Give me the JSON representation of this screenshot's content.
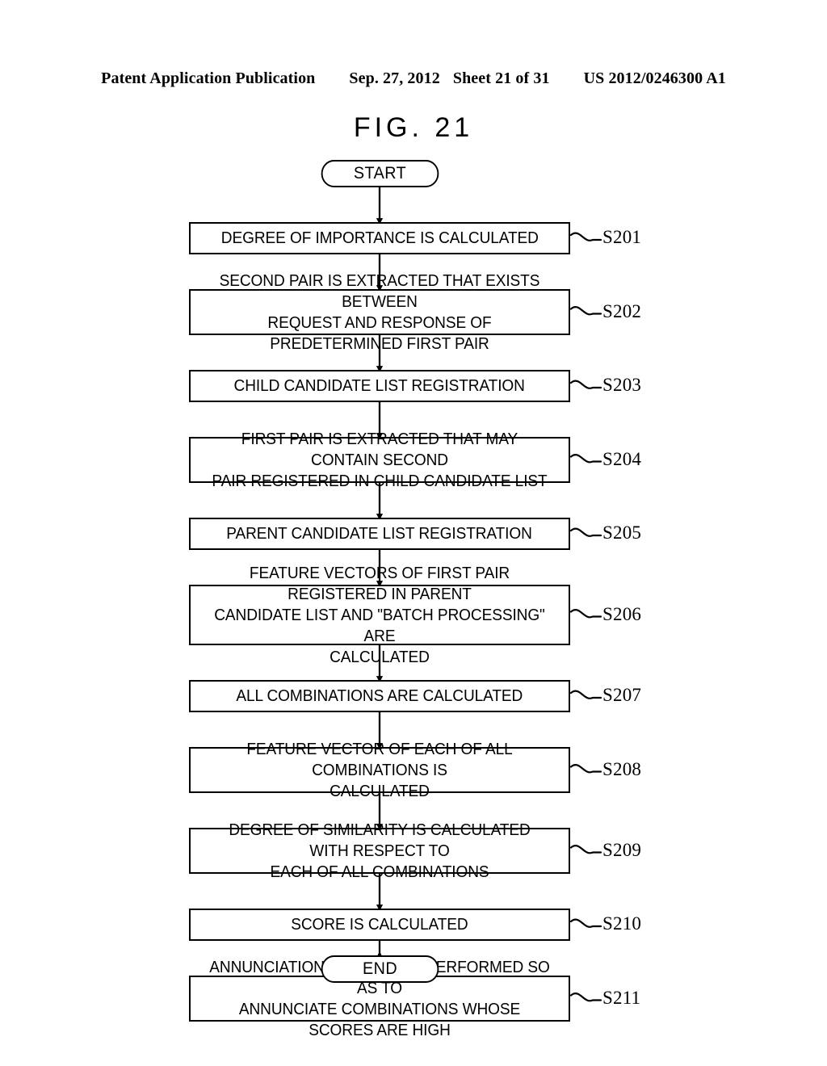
{
  "header": {
    "publication": "Patent Application Publication",
    "date": "Sep. 27, 2012",
    "sheet": "Sheet 21 of 31",
    "patent_number": "US 2012/0246300 A1"
  },
  "figure": {
    "title": "FIG. 21"
  },
  "flowchart": {
    "start_label": "START",
    "end_label": "END",
    "steps": [
      {
        "ref": "S201",
        "text": "DEGREE OF IMPORTANCE IS CALCULATED",
        "lines": 1
      },
      {
        "ref": "S202",
        "text": "SECOND PAIR IS EXTRACTED THAT EXISTS BETWEEN\nREQUEST AND RESPONSE OF PREDETERMINED FIRST PAIR",
        "lines": 2
      },
      {
        "ref": "S203",
        "text": "CHILD CANDIDATE LIST REGISTRATION",
        "lines": 1
      },
      {
        "ref": "S204",
        "text": "FIRST PAIR IS EXTRACTED THAT MAY CONTAIN SECOND\nPAIR REGISTERED IN CHILD CANDIDATE LIST",
        "lines": 2
      },
      {
        "ref": "S205",
        "text": "PARENT CANDIDATE LIST REGISTRATION",
        "lines": 1
      },
      {
        "ref": "S206",
        "text": "FEATURE VECTORS OF FIRST PAIR REGISTERED IN PARENT\nCANDIDATE LIST AND \"BATCH PROCESSING\" ARE\nCALCULATED",
        "lines": 3
      },
      {
        "ref": "S207",
        "text": "ALL COMBINATIONS ARE CALCULATED",
        "lines": 1
      },
      {
        "ref": "S208",
        "text": "FEATURE VECTOR OF EACH OF ALL COMBINATIONS IS\nCALCULATED",
        "lines": 2
      },
      {
        "ref": "S209",
        "text": "DEGREE OF SIMILARITY IS CALCULATED WITH RESPECT TO\nEACH OF ALL COMBINATIONS",
        "lines": 2
      },
      {
        "ref": "S210",
        "text": "SCORE IS CALCULATED",
        "lines": 1
      },
      {
        "ref": "S211",
        "text": "ANNUNCIATION CONTROL IS PERFORMED SO AS TO\nANNUNCIATE COMBINATIONS WHOSE SCORES ARE HIGH",
        "lines": 2
      }
    ]
  },
  "colors": {
    "ink": "#000000",
    "paper": "#ffffff"
  }
}
